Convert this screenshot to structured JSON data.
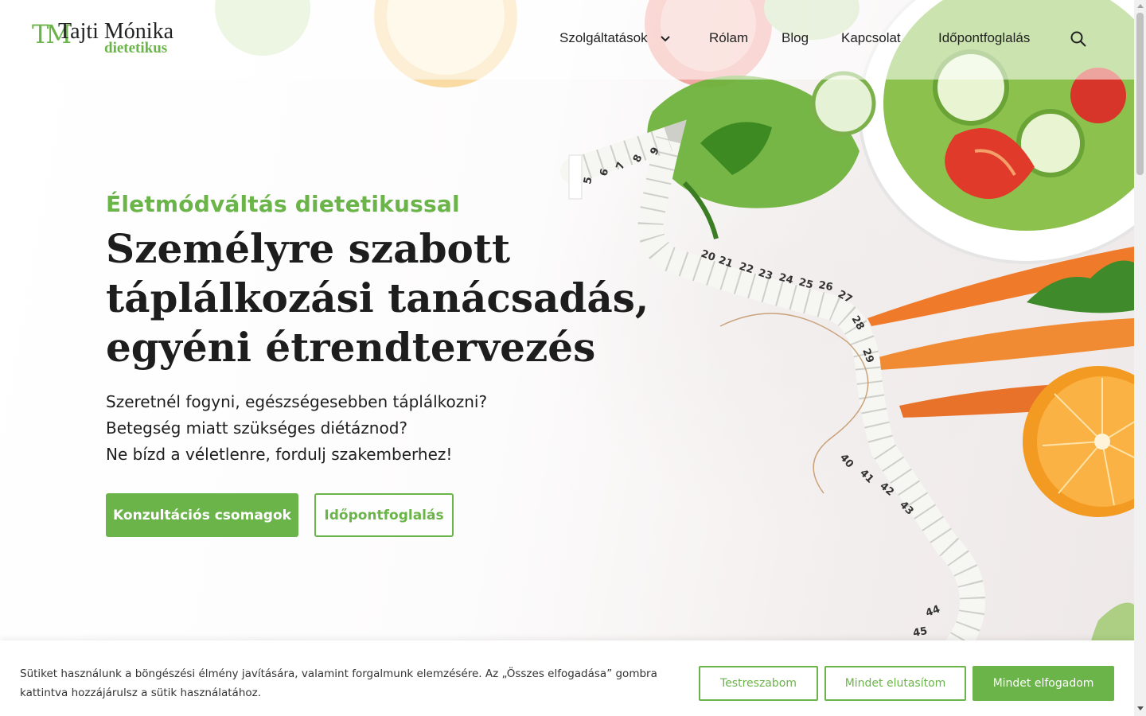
{
  "brand": {
    "mark": "TM",
    "name": "Tajti Mónika",
    "subtitle": "dietetikus",
    "accent_color": "#6bb44a"
  },
  "nav": {
    "items": [
      {
        "label": "Szolgáltatások",
        "has_dropdown": true
      },
      {
        "label": "Rólam"
      },
      {
        "label": "Blog"
      },
      {
        "label": "Kapcsolat"
      },
      {
        "label": "Időpontfoglalás"
      }
    ],
    "search_icon": "search-icon"
  },
  "hero": {
    "eyebrow": "Életmódváltás dietetikussal",
    "headline_lines": [
      "Személyre szabott",
      "táplálkozási tanácsadás,",
      "egyéni étrendtervezés"
    ],
    "lead_lines": [
      "Szeretnél fogyni, egészségesebben táplálkozni?",
      "Betegség miatt szükséges diétáznod?",
      "Ne bízd a véletlenre, fordulj szakemberhez!"
    ],
    "primary_button": "Konzultációs csomagok",
    "secondary_button": "Időpontfoglalás"
  },
  "cookie_banner": {
    "text": "Sütiket használunk a böngészési élmény javítására, valamint forgalmunk elemzésére. Az „Összes elfogadása” gombra kattintva hozzájárulsz a sütik használatához.",
    "customize_button": "Testreszabom",
    "reject_button": "Mindet elutasítom",
    "accept_button": "Mindet elfogadom"
  },
  "tape_numbers": [
    "5",
    "6",
    "7",
    "8",
    "9",
    "20",
    "21",
    "22",
    "23",
    "24",
    "25",
    "26",
    "27",
    "28",
    "29",
    "40",
    "41",
    "42",
    "43",
    "44",
    "45"
  ]
}
